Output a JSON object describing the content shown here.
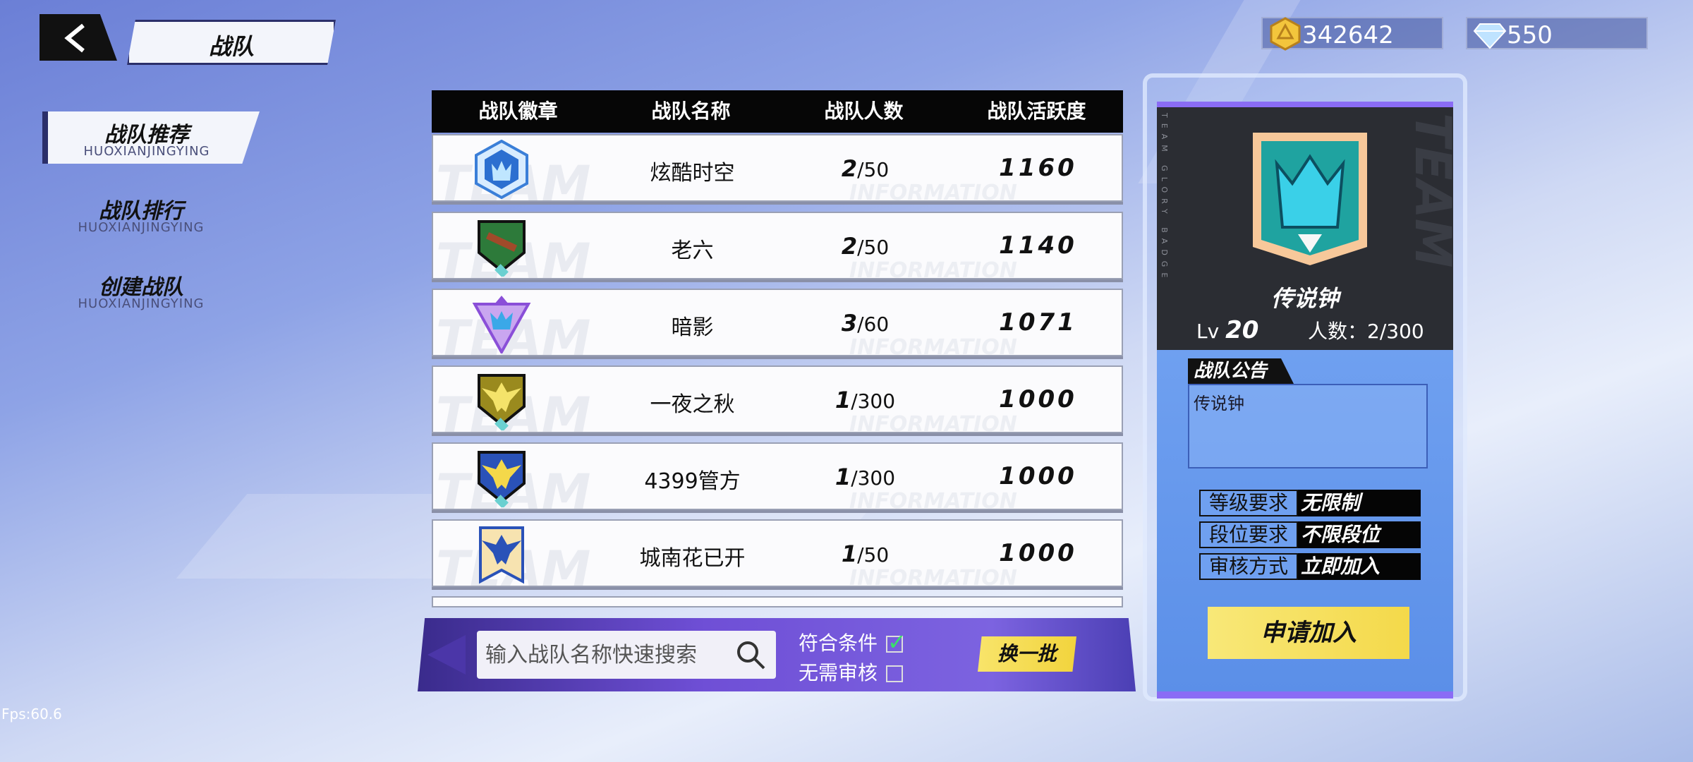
{
  "header": {
    "title": "战队"
  },
  "menu": [
    {
      "label": "战队推荐",
      "sub": "HUOXIANJINGYING",
      "active": true
    },
    {
      "label": "战队排行",
      "sub": "HUOXIANJINGYING",
      "active": false
    },
    {
      "label": "创建战队",
      "sub": "HUOXIANJINGYING",
      "active": false
    }
  ],
  "currency": {
    "coins": "342642",
    "diamonds": "550"
  },
  "table": {
    "headers": [
      "战队徽章",
      "战队名称",
      "战队人数",
      "战队活跃度"
    ],
    "watermark_left": "TEAM",
    "watermark_right": "INFORMATION",
    "rows": [
      {
        "badge": "blue-crown-badge",
        "name": "炫酷时空",
        "members": "2",
        "capacity": "/50",
        "activity": "1160"
      },
      {
        "badge": "green-gun-badge",
        "name": "老六",
        "members": "2",
        "capacity": "/50",
        "activity": "1140"
      },
      {
        "badge": "purple-triangle-badge",
        "name": "暗影",
        "members": "3",
        "capacity": "/60",
        "activity": "1071"
      },
      {
        "badge": "gold-eagle-badge",
        "name": "一夜之秋",
        "members": "1",
        "capacity": "/300",
        "activity": "1000"
      },
      {
        "badge": "blue-eagle-badge",
        "name": "4399管方",
        "members": "1",
        "capacity": "/300",
        "activity": "1000"
      },
      {
        "badge": "gold-eagle-banner-badge",
        "name": "城南花已开",
        "members": "1",
        "capacity": "/50",
        "activity": "1000"
      }
    ]
  },
  "search": {
    "placeholder": "输入战队名称快速搜索",
    "filter_qualified": "符合条件",
    "filter_qualified_checked": true,
    "filter_no_review": "无需审核",
    "filter_no_review_checked": false,
    "refresh_label": "换一批"
  },
  "card": {
    "side_text": "TEAM GLORY BADGE",
    "watermark": "TEAM",
    "name": "传说钟",
    "level_prefix": "Lv",
    "level": "20",
    "member_count": "人数：2/300",
    "notice_label": "战队公告",
    "notice_text": "传说钟",
    "requirements": [
      {
        "key": "等级要求",
        "value": "无限制"
      },
      {
        "key": "段位要求",
        "value": "不限段位"
      },
      {
        "key": "审核方式",
        "value": "立即加入"
      }
    ],
    "join_label": "申请加入"
  },
  "fps": "Fps:60.6",
  "colors": {
    "accent_purple": "#8a6cf5",
    "button_yellow": "#f4d94a",
    "check_green": "#39e06a"
  }
}
